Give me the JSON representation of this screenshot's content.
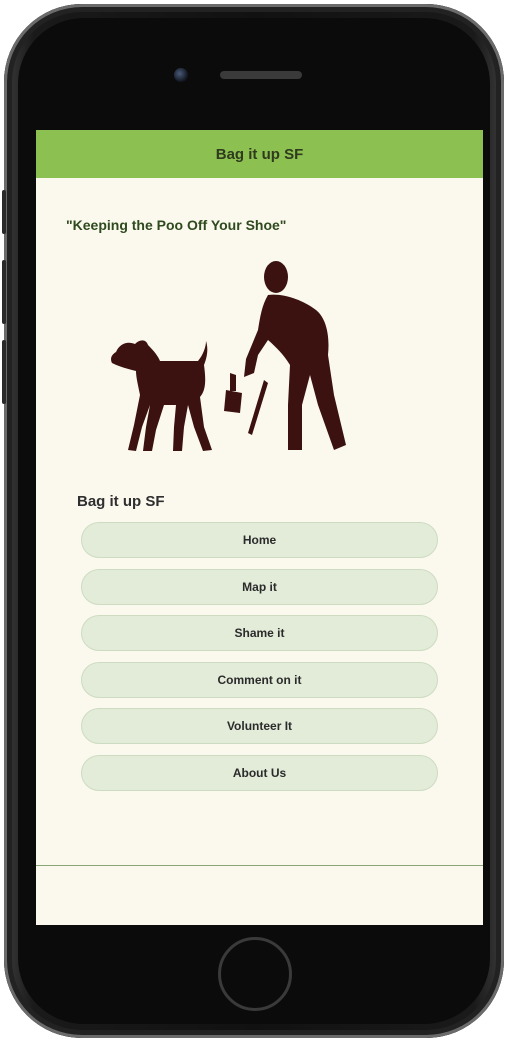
{
  "app": {
    "title": "Bag it up SF"
  },
  "hero": {
    "tagline": "\"Keeping the Poo Off Your Shoe\""
  },
  "nav": {
    "heading": "Bag it up SF",
    "items": [
      {
        "label": "Home"
      },
      {
        "label": "Map it"
      },
      {
        "label": "Shame it"
      },
      {
        "label": "Comment on it"
      },
      {
        "label": "Volunteer It"
      },
      {
        "label": "About Us"
      }
    ]
  },
  "colors": {
    "header": "#8cc152",
    "background": "#fbf8ed",
    "button": "#e2ecd9",
    "illustration": "#3b1210"
  }
}
